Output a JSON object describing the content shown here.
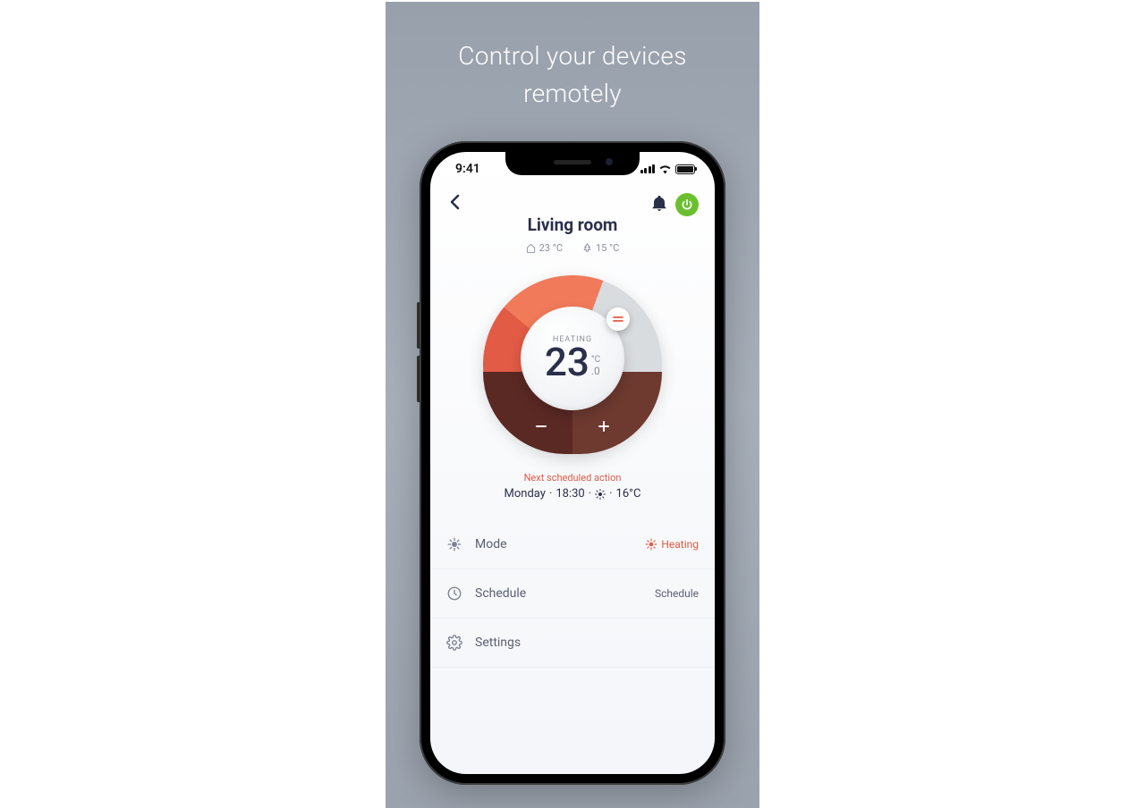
{
  "promo": {
    "title_line1": "Control your devices",
    "title_line2": "remotely"
  },
  "status_bar": {
    "time": "9:41"
  },
  "header": {
    "room_title": "Living room",
    "indoor_temp": "23 °C",
    "outdoor_temp": "15 °C"
  },
  "dial": {
    "status_label": "HEATING",
    "temp_int": "23",
    "temp_unit": "°C",
    "temp_decimal": ".0"
  },
  "next_action": {
    "label": "Next scheduled action",
    "day": "Monday",
    "time": "18:30",
    "temp": "16°C"
  },
  "menu": {
    "mode": {
      "label": "Mode",
      "value": "Heating"
    },
    "schedule": {
      "label": "Schedule",
      "value": "Schedule"
    },
    "settings": {
      "label": "Settings"
    }
  }
}
